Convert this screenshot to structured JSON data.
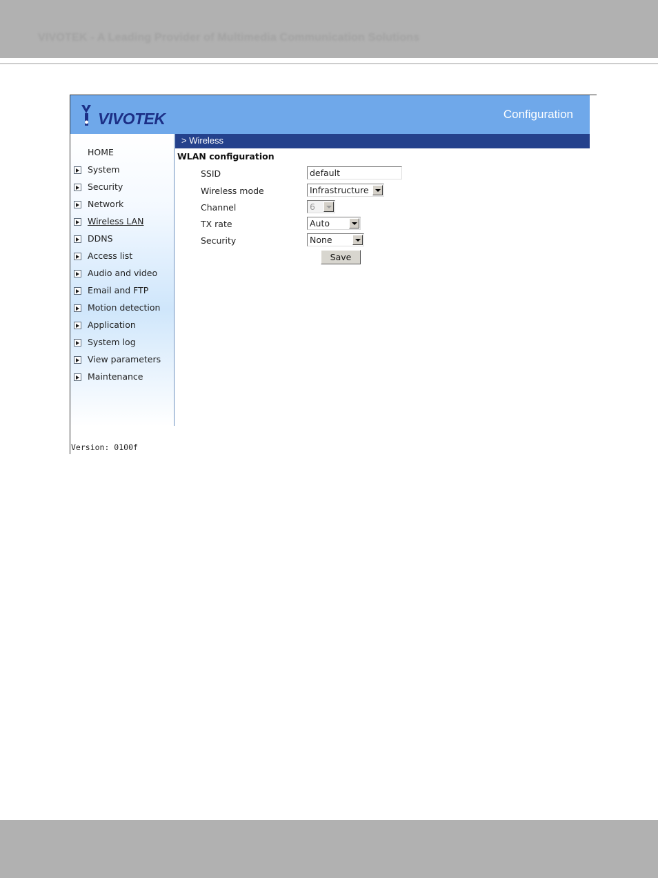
{
  "document": {
    "header_text": "VIVOTEK - A Leading Provider of Multimedia Communication Solutions"
  },
  "app": {
    "logo_text": "VIVOTEK",
    "page_title": "Configuration"
  },
  "sidebar": {
    "items": [
      {
        "label": "HOME",
        "icon": "none"
      },
      {
        "label": "System",
        "icon": "arrow-right-icon"
      },
      {
        "label": "Security",
        "icon": "arrow-right-icon"
      },
      {
        "label": "Network",
        "icon": "arrow-right-icon"
      },
      {
        "label": "Wireless LAN",
        "icon": "arrow-right-icon",
        "current": true
      },
      {
        "label": "DDNS",
        "icon": "arrow-right-icon"
      },
      {
        "label": "Access list",
        "icon": "arrow-right-icon"
      },
      {
        "label": "Audio and video",
        "icon": "arrow-right-icon"
      },
      {
        "label": "Email and FTP",
        "icon": "arrow-right-icon"
      },
      {
        "label": "Motion detection",
        "icon": "arrow-right-icon"
      },
      {
        "label": "Application",
        "icon": "arrow-right-icon"
      },
      {
        "label": "System log",
        "icon": "arrow-right-icon"
      },
      {
        "label": "View parameters",
        "icon": "arrow-right-icon"
      },
      {
        "label": "Maintenance",
        "icon": "arrow-right-icon"
      }
    ],
    "version": "Version: 0100f"
  },
  "main": {
    "breadcrumb": "> Wireless",
    "section_title": "WLAN configuration",
    "fields": {
      "ssid": {
        "label": "SSID",
        "value": "default"
      },
      "wireless_mode": {
        "label": "Wireless mode",
        "value": "Infrastructure"
      },
      "channel": {
        "label": "Channel",
        "value": "6",
        "disabled": true
      },
      "tx_rate": {
        "label": "TX rate",
        "value": "Auto"
      },
      "security": {
        "label": "Security",
        "value": "None"
      }
    },
    "save_label": "Save"
  },
  "colors": {
    "banner": "#6fa8ea",
    "titlebar": "#24418c",
    "logo": "#1c2f86",
    "page_band": "#b1b1b1"
  }
}
